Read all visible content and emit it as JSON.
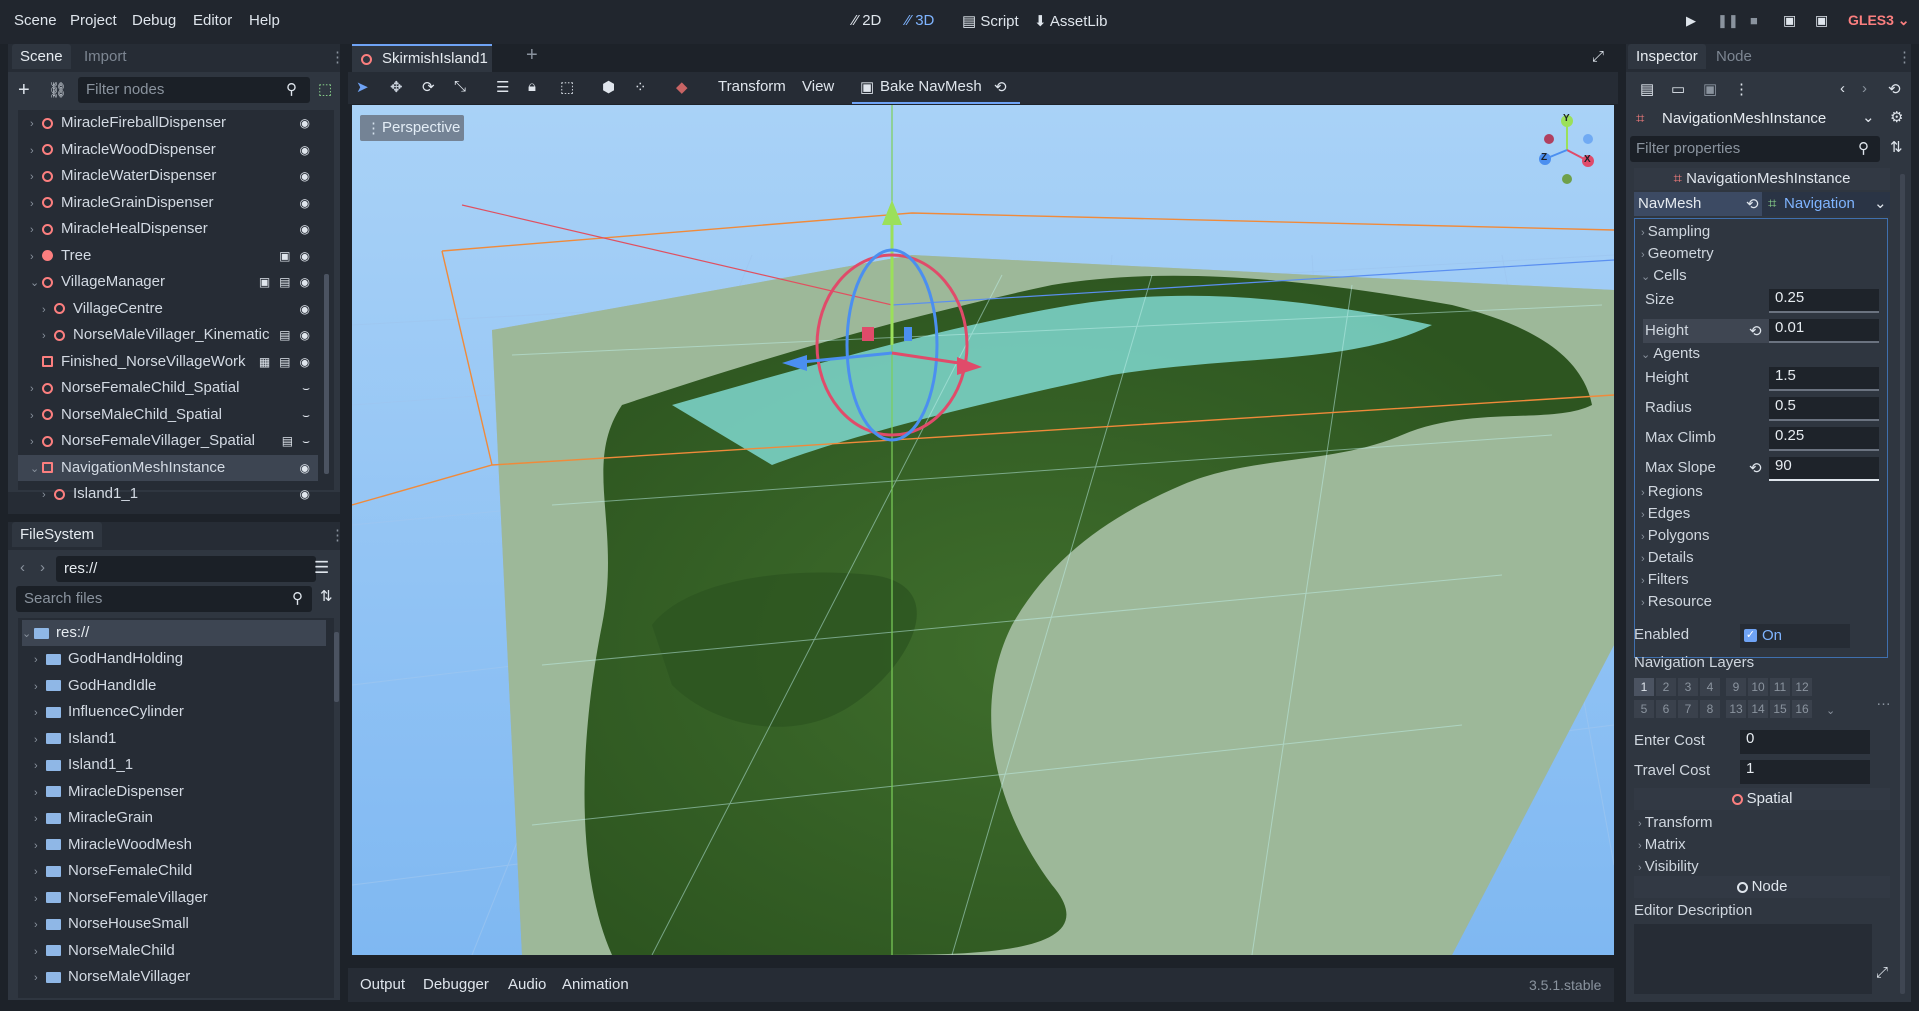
{
  "menu": [
    "Scene",
    "Project",
    "Debug",
    "Editor",
    "Help"
  ],
  "workspaces": [
    {
      "label": "2D",
      "icon": "2d-icon"
    },
    {
      "label": "3D",
      "icon": "3d-icon",
      "active": true
    },
    {
      "label": "Script",
      "icon": "script-icon"
    },
    {
      "label": "AssetLib",
      "icon": "assetlib-icon"
    }
  ],
  "renderer": "GLES3",
  "scene_dock": {
    "tabs": [
      "Scene",
      "Import"
    ],
    "filter_placeholder": "Filter nodes",
    "nodes": [
      {
        "label": "MiracleFireballDispenser",
        "indent": 1,
        "arrow": "›"
      },
      {
        "label": "MiracleWoodDispenser",
        "indent": 1,
        "arrow": "›"
      },
      {
        "label": "MiracleWaterDispenser",
        "indent": 1,
        "arrow": "›"
      },
      {
        "label": "MiracleGrainDispenser",
        "indent": 1,
        "arrow": "›"
      },
      {
        "label": "MiracleHealDispenser",
        "indent": 1,
        "arrow": "›"
      },
      {
        "label": "Tree",
        "indent": 1,
        "arrow": "›"
      },
      {
        "label": "VillageManager",
        "indent": 1,
        "arrow": "⌄"
      },
      {
        "label": "VillageCentre",
        "indent": 2,
        "arrow": "›"
      },
      {
        "label": "NorseMaleVillager_Kinematic",
        "indent": 2,
        "arrow": "›"
      },
      {
        "label": "Finished_NorseVillageWork",
        "indent": 1,
        "arrow": ""
      },
      {
        "label": "NorseFemaleChild_Spatial",
        "indent": 1,
        "arrow": "›"
      },
      {
        "label": "NorseMaleChild_Spatial",
        "indent": 1,
        "arrow": "›"
      },
      {
        "label": "NorseFemaleVillager_Spatial",
        "indent": 1,
        "arrow": "›"
      },
      {
        "label": "NavigationMeshInstance",
        "indent": 1,
        "arrow": "⌄",
        "selected": true
      },
      {
        "label": "Island1_1",
        "indent": 2,
        "arrow": "›"
      }
    ]
  },
  "filesystem": {
    "tab": "FileSystem",
    "path": "res://",
    "search_placeholder": "Search files",
    "root": "res://",
    "folders": [
      "GodHandHolding",
      "GodHandIdle",
      "InfluenceCylinder",
      "Island1",
      "Island1_1",
      "MiracleDispenser",
      "MiracleGrain",
      "MiracleWoodMesh",
      "NorseFemaleChild",
      "NorseFemaleVillager",
      "NorseHouseSmall",
      "NorseMaleChild",
      "NorseMaleVillager"
    ]
  },
  "editor": {
    "scene_tab": "SkirmishIsland1",
    "toolbar": {
      "transform": "Transform",
      "view": "View",
      "bake": "Bake NavMesh"
    },
    "viewport_label": "Perspective",
    "gizmo_axes": [
      "Y",
      "Z",
      "X"
    ]
  },
  "bottom_panel": {
    "tabs": [
      "Output",
      "Debugger",
      "Audio",
      "Animation"
    ],
    "version": "3.5.1.stable"
  },
  "inspector": {
    "tabs": [
      "Inspector",
      "Node"
    ],
    "node_type": "NavigationMeshInstance",
    "filter_placeholder": "Filter properties",
    "header": "NavigationMeshInstance",
    "navmesh_label": "NavMesh",
    "navmesh_value": "Navigation",
    "groups_top": [
      "Sampling",
      "Geometry"
    ],
    "cells": {
      "label": "Cells",
      "size_label": "Size",
      "size": "0.25",
      "height_label": "Height",
      "height": "0.01"
    },
    "agents": {
      "label": "Agents",
      "height_label": "Height",
      "height": "1.5",
      "radius_label": "Radius",
      "radius": "0.5",
      "max_climb_label": "Max Climb",
      "max_climb": "0.25",
      "max_slope_label": "Max Slope",
      "max_slope": "90"
    },
    "groups_bottom": [
      "Regions",
      "Edges",
      "Polygons",
      "Details",
      "Filters",
      "Resource"
    ],
    "enabled_label": "Enabled",
    "enabled_value": "On",
    "nav_layers_label": "Navigation Layers",
    "layers_row1": [
      "1",
      "2",
      "3",
      "4",
      "9",
      "10",
      "11",
      "12"
    ],
    "layers_row2": [
      "5",
      "6",
      "7",
      "8",
      "13",
      "14",
      "15",
      "16"
    ],
    "enter_cost_label": "Enter Cost",
    "enter_cost": "0",
    "travel_cost_label": "Travel Cost",
    "travel_cost": "1",
    "spatial_header": "Spatial",
    "spatial_groups": [
      "Transform",
      "Matrix",
      "Visibility"
    ],
    "node_header": "Node",
    "editor_description": "Editor Description"
  },
  "colors": {
    "accent": "#6fa3f5",
    "node_red": "#fc7f7f",
    "sky": "#8ec1f5"
  }
}
